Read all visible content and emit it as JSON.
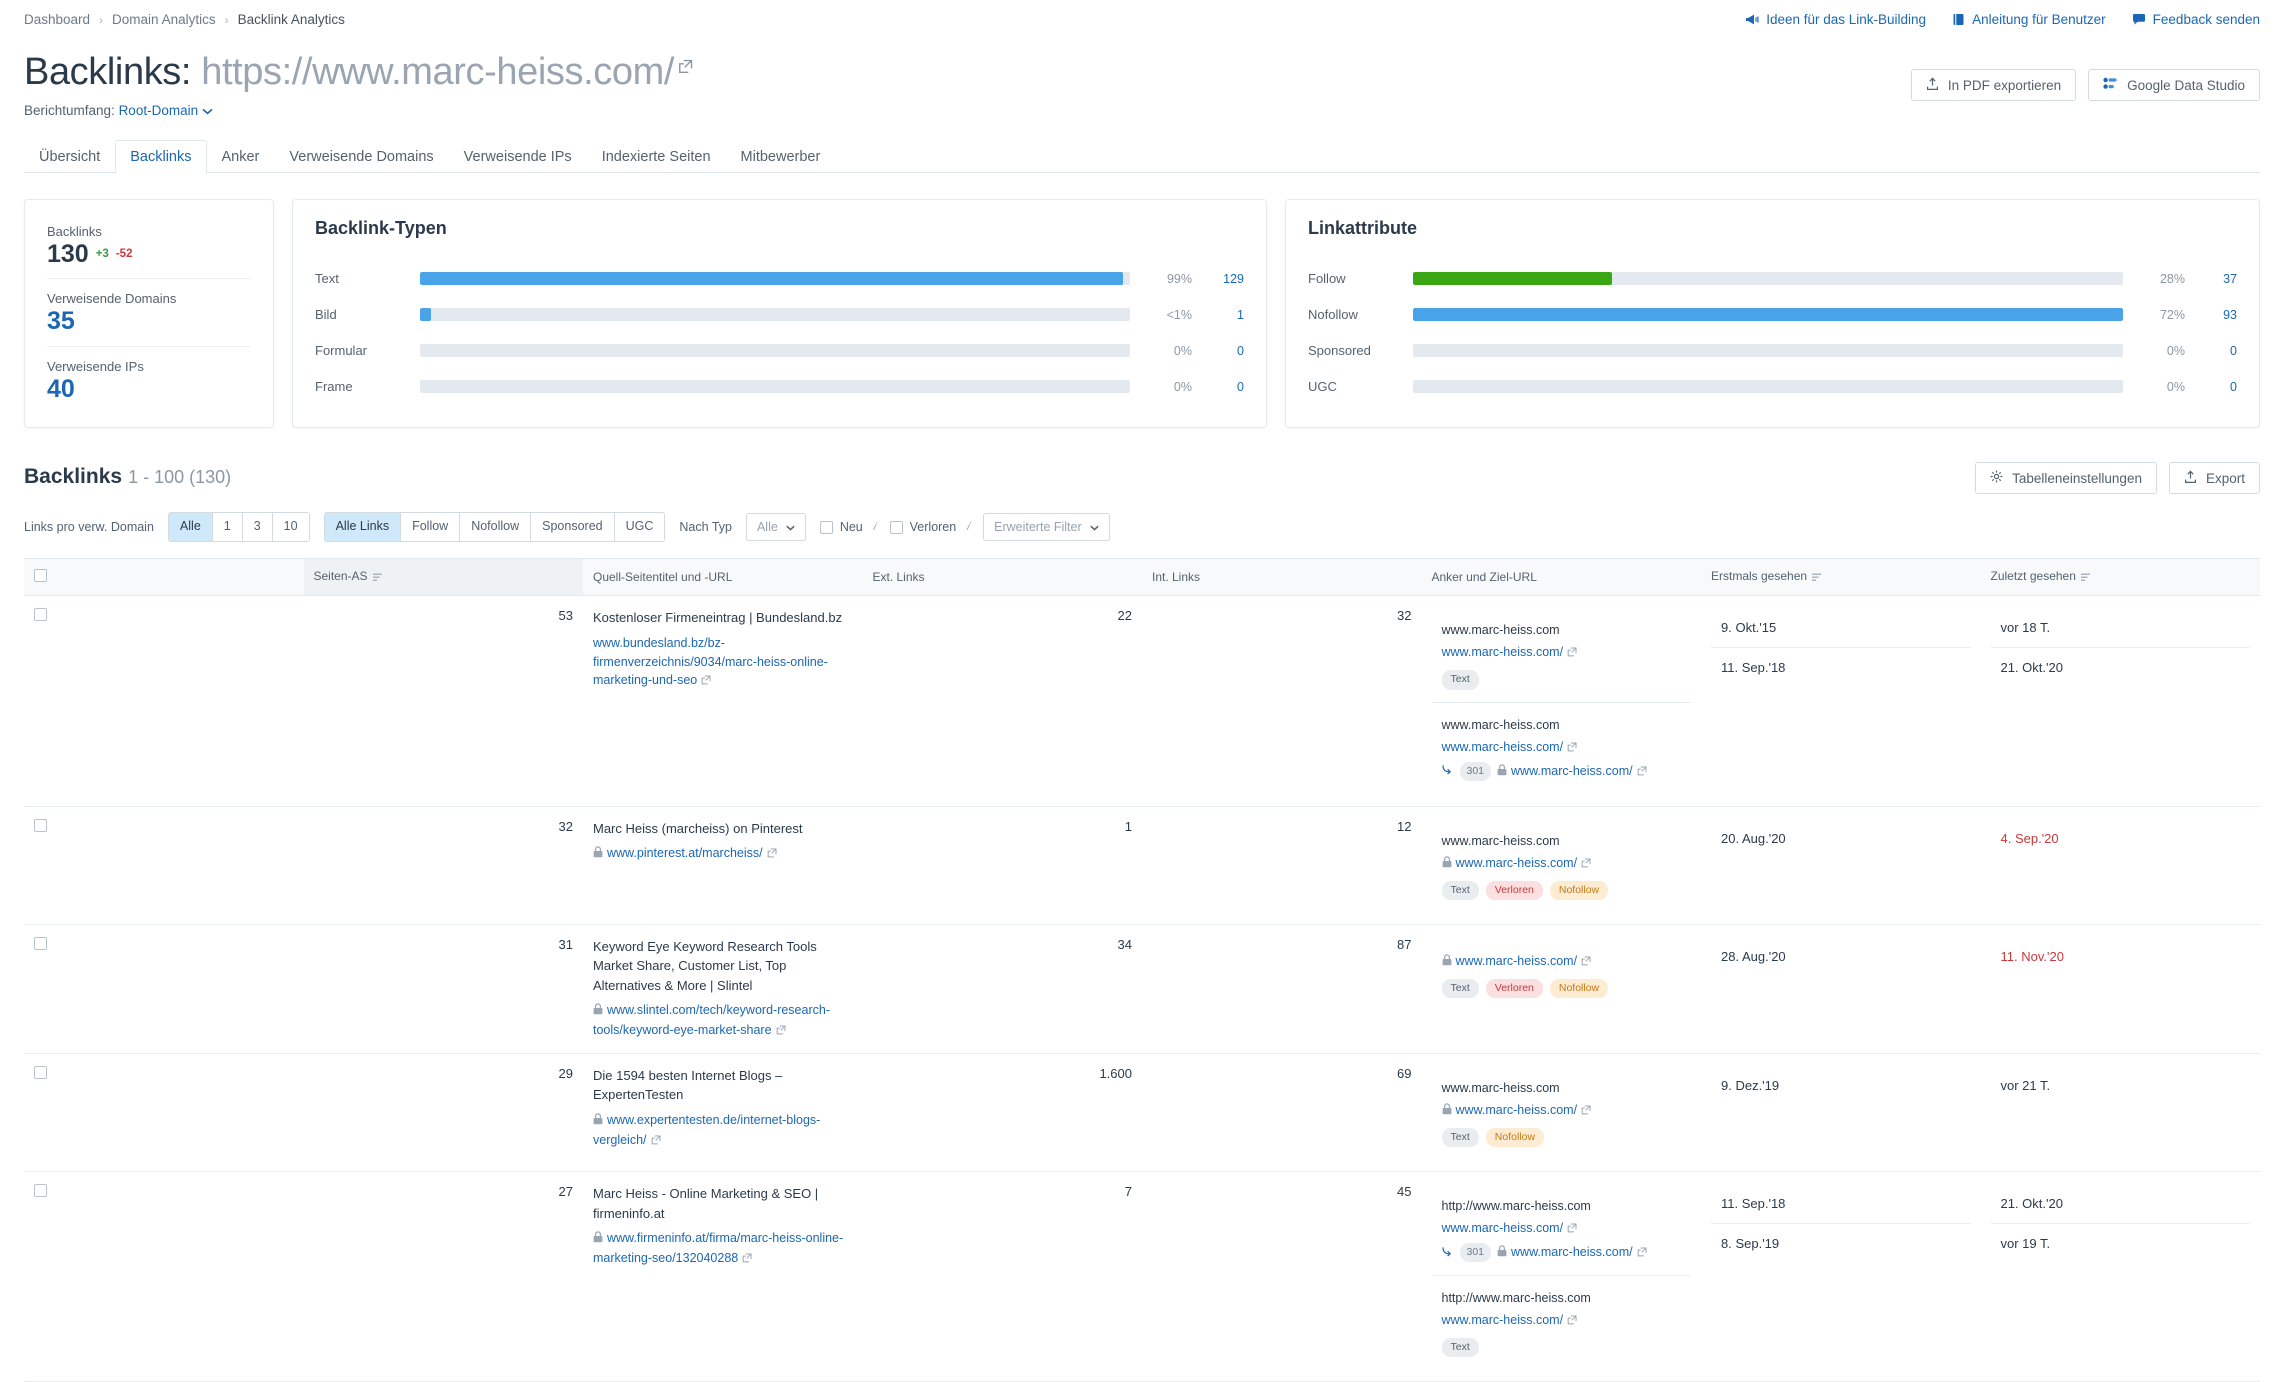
{
  "breadcrumb": {
    "items": [
      "Dashboard",
      "Domain Analytics",
      "Backlink Analytics"
    ]
  },
  "top_links": [
    {
      "label": "Ideen für das Link-Building",
      "icon": "megaphone-icon"
    },
    {
      "label": "Anleitung für Benutzer",
      "icon": "book-icon"
    },
    {
      "label": "Feedback senden",
      "icon": "speech-bubble-icon"
    }
  ],
  "header": {
    "title_prefix": "Backlinks:",
    "domain": "https://www.marc-heiss.com/",
    "export_pdf_label": "In PDF exportieren",
    "data_studio_label": "Google Data Studio",
    "scope_label": "Berichtumfang:",
    "scope_value": "Root-Domain"
  },
  "tabs": [
    {
      "label": "Übersicht",
      "active": false
    },
    {
      "label": "Backlinks",
      "active": true
    },
    {
      "label": "Anker",
      "active": false
    },
    {
      "label": "Verweisende Domains",
      "active": false
    },
    {
      "label": "Verweisende IPs",
      "active": false
    },
    {
      "label": "Indexierte Seiten",
      "active": false
    },
    {
      "label": "Mitbewerber",
      "active": false
    }
  ],
  "summary": [
    {
      "label": "Backlinks",
      "value": "130",
      "delta_up": "+3",
      "delta_down": "-52",
      "blue": false
    },
    {
      "label": "Verweisende Domains",
      "value": "35",
      "blue": true
    },
    {
      "label": "Verweisende IPs",
      "value": "40",
      "blue": true
    }
  ],
  "chart_data": [
    {
      "type": "bar",
      "title": "Backlink-Typen",
      "orientation": "horizontal",
      "categories": [
        "Text",
        "Bild",
        "Formular",
        "Frame"
      ],
      "values": [
        129,
        1,
        0,
        0
      ],
      "percent_labels": [
        "99%",
        "<1%",
        "0%",
        "0%"
      ],
      "percents": [
        99,
        1,
        0,
        0
      ],
      "bar_widths_pct": [
        99,
        1.5,
        0,
        0
      ],
      "colors": [
        "#48a3e8",
        "#48a3e8",
        "#48a3e8",
        "#48a3e8"
      ],
      "track_color": "#e3e9ee",
      "xlabel": "",
      "ylabel": "",
      "grid": false,
      "legend": "none"
    },
    {
      "type": "bar",
      "title": "Linkattribute",
      "orientation": "horizontal",
      "categories": [
        "Follow",
        "Nofollow",
        "Sponsored",
        "UGC"
      ],
      "values": [
        37,
        93,
        0,
        0
      ],
      "percent_labels": [
        "28%",
        "72%",
        "0%",
        "0%"
      ],
      "percents": [
        28,
        72,
        0,
        0
      ],
      "bar_widths_pct": [
        28,
        100,
        0,
        0
      ],
      "colors": [
        "#3ba614",
        "#48a3e8",
        "#48a3e8",
        "#48a3e8"
      ],
      "track_color": "#e3e9ee",
      "xlabel": "",
      "ylabel": "",
      "grid": false,
      "legend": "none"
    }
  ],
  "table_section": {
    "title": "Backlinks",
    "count_text": "1 - 100 (130)",
    "settings_label": "Tabelleneinstellungen",
    "export_label": "Export"
  },
  "filters": {
    "links_per_domain_label": "Links pro verw. Domain",
    "links_per_domain_options": [
      "Alle",
      "1",
      "3",
      "10"
    ],
    "links_per_domain_selected": "Alle",
    "link_type_options": [
      "Alle Links",
      "Follow",
      "Nofollow",
      "Sponsored",
      "UGC"
    ],
    "link_type_selected": "Alle Links",
    "by_type_label": "Nach Typ",
    "by_type_value": "Alle",
    "new_label": "Neu",
    "lost_label": "Verloren",
    "advanced_label": "Erweiterte Filter"
  },
  "table": {
    "columns": [
      "Seiten-AS",
      "Quell-Seitentitel und -URL",
      "Ext. Links",
      "Int. Links",
      "Anker und Ziel-URL",
      "Erstmals gesehen",
      "Zuletzt gesehen"
    ],
    "rows": [
      {
        "as": "53",
        "source_title": "Kostenloser Firmeneintrag | Bundesland.bz",
        "source_url": "www.bundesland.bz/bz-firmenverzeichnis/9034/marc-heiss-online-marketing-und-seo",
        "source_secure": false,
        "ext_links": "22",
        "int_links": "32",
        "anchors": [
          {
            "anchor_text": "www.marc-heiss.com",
            "target_url": "www.marc-heiss.com/",
            "target_secure": false,
            "redirect": null,
            "tags": [
              {
                "label": "Text",
                "kind": "text"
              }
            ],
            "first_seen": "9. Okt.'15",
            "last_seen": "vor 18 T.",
            "last_seen_lost": false
          },
          {
            "anchor_text": "www.marc-heiss.com",
            "target_url": "www.marc-heiss.com/",
            "target_secure": false,
            "redirect": {
              "code": "301",
              "url": "www.marc-heiss.com/",
              "secure": true
            },
            "tags": [],
            "first_seen": "11. Sep.'18",
            "last_seen": "21. Okt.'20",
            "last_seen_lost": false
          }
        ]
      },
      {
        "as": "32",
        "source_title": "Marc Heiss (marcheiss) on Pinterest",
        "source_url": "www.pinterest.at/marcheiss/",
        "source_secure": true,
        "ext_links": "1",
        "int_links": "12",
        "anchors": [
          {
            "anchor_text": "www.marc-heiss.com",
            "target_url": "www.marc-heiss.com/",
            "target_secure": true,
            "redirect": null,
            "tags": [
              {
                "label": "Text",
                "kind": "text"
              },
              {
                "label": "Verloren",
                "kind": "lost"
              },
              {
                "label": "Nofollow",
                "kind": "nofollow"
              }
            ],
            "first_seen": "20. Aug.'20",
            "last_seen": "4. Sep.'20",
            "last_seen_lost": true
          }
        ]
      },
      {
        "as": "31",
        "source_title": "Keyword Eye Keyword Research Tools Market Share, Customer List, Top Alternatives &amp; More | Slintel",
        "source_url": "www.slintel.com/tech/keyword-research-tools/keyword-eye-market-share",
        "source_secure": true,
        "ext_links": "34",
        "int_links": "87",
        "anchors": [
          {
            "anchor_text": "",
            "target_url": "www.marc-heiss.com/",
            "target_secure": true,
            "redirect": null,
            "tags": [
              {
                "label": "Text",
                "kind": "text"
              },
              {
                "label": "Verloren",
                "kind": "lost"
              },
              {
                "label": "Nofollow",
                "kind": "nofollow"
              }
            ],
            "first_seen": "28. Aug.'20",
            "last_seen": "11. Nov.'20",
            "last_seen_lost": true
          }
        ]
      },
      {
        "as": "29",
        "source_title": "Die 1594 besten Internet Blogs – ExpertenTesten",
        "source_url": "www.expertentesten.de/internet-blogs-vergleich/",
        "source_secure": true,
        "ext_links": "1.600",
        "int_links": "69",
        "anchors": [
          {
            "anchor_text": "www.marc-heiss.com",
            "target_url": "www.marc-heiss.com/",
            "target_secure": true,
            "redirect": null,
            "tags": [
              {
                "label": "Text",
                "kind": "text"
              },
              {
                "label": "Nofollow",
                "kind": "nofollow"
              }
            ],
            "first_seen": "9. Dez.'19",
            "last_seen": "vor 21 T.",
            "last_seen_lost": false
          }
        ]
      },
      {
        "as": "27",
        "source_title": "Marc Heiss - Online Marketing & SEO | firmeninfo.at",
        "source_url": "www.firmeninfo.at/firma/marc-heiss-online-marketing-seo/132040288",
        "source_secure": true,
        "ext_links": "7",
        "int_links": "45",
        "anchors": [
          {
            "anchor_text": "http://www.marc-heiss.com",
            "target_url": "www.marc-heiss.com/",
            "target_secure": false,
            "redirect": {
              "code": "301",
              "url": "www.marc-heiss.com/",
              "secure": true
            },
            "tags": [],
            "first_seen": "11. Sep.'18",
            "last_seen": "21. Okt.'20",
            "last_seen_lost": false
          },
          {
            "anchor_text": "http://www.marc-heiss.com",
            "target_url": "www.marc-heiss.com/",
            "target_secure": false,
            "redirect": null,
            "tags": [
              {
                "label": "Text",
                "kind": "text"
              }
            ],
            "first_seen": "8. Sep.'19",
            "last_seen": "vor 19 T.",
            "last_seen_lost": false
          }
        ]
      }
    ]
  },
  "colors": {
    "link": "#1c67b3",
    "blue_bar": "#48a3e8",
    "green_bar": "#3ba614",
    "track": "#e3e9ee",
    "lost_red": "#c8393c",
    "up_green": "#3e9a42"
  }
}
